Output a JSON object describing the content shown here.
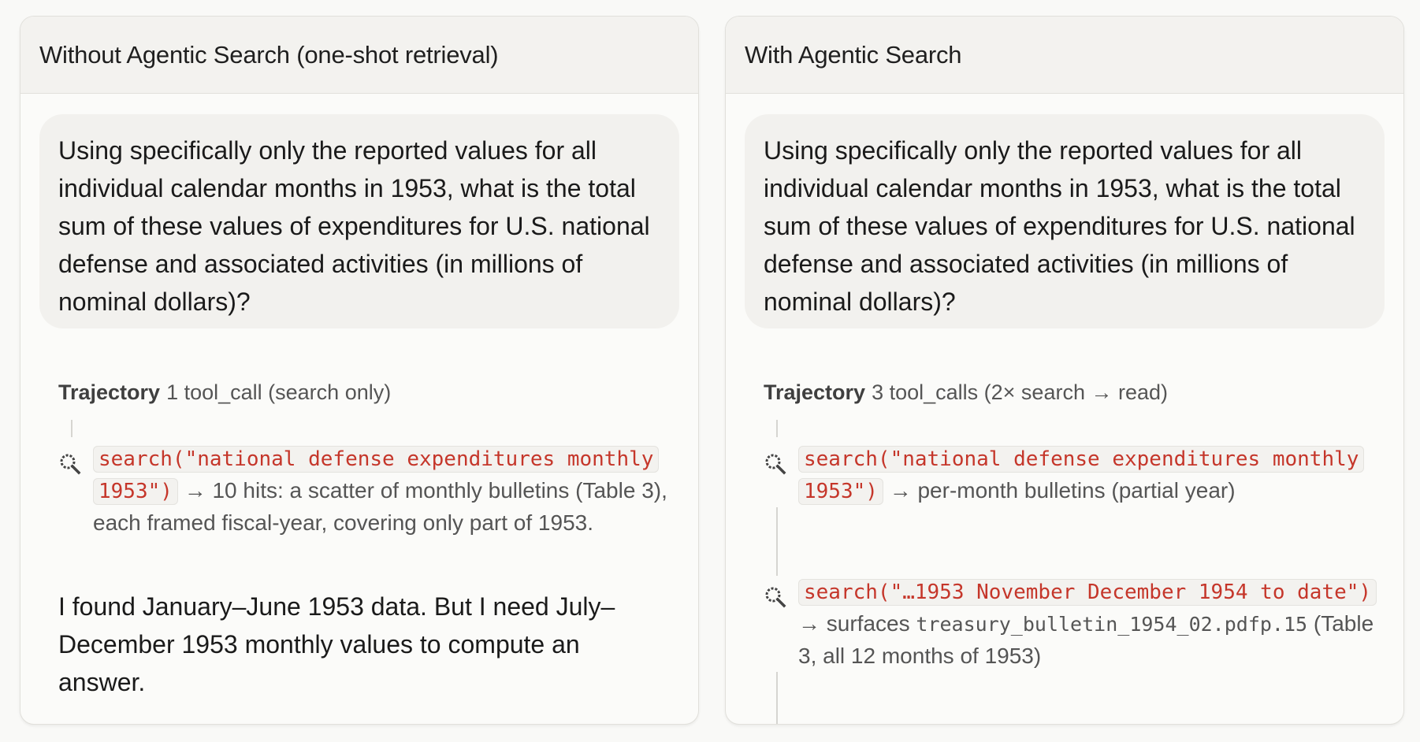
{
  "left_panel": {
    "title": "Without Agentic Search (one-shot retrieval)",
    "question": "Using specifically only the reported values for all individual calendar months in 1953, what is the total sum of these values of expenditures for U.S. national defense and associated activities (in millions of nominal dollars)?",
    "trajectory_label": "Trajectory",
    "trajectory_summary": "1 tool_call (search only)",
    "steps": [
      {
        "icon": "search-icon",
        "call": "search(\"national defense expenditures monthly 1953\")",
        "result": "→ 10 hits: a scatter of monthly bulletins (Table 3), each framed fiscal-year, covering only part of 1953."
      }
    ],
    "answer": "I found January–June 1953 data. But I need July–December 1953 monthly values to compute an answer."
  },
  "right_panel": {
    "title": "With Agentic Search",
    "question": "Using specifically only the reported values for all individual calendar months in 1953, what is the total sum of these values of expenditures for U.S. national defense and associated activities (in millions of nominal dollars)?",
    "trajectory_label": "Trajectory",
    "trajectory_summary": "3 tool_calls (2× search → read)",
    "steps": [
      {
        "icon": "search-icon",
        "call": "search(\"national defense expenditures monthly 1953\")",
        "result": "→ per-month bulletins (partial year)"
      },
      {
        "icon": "search-icon",
        "call": "search(\"…1953 November December 1954 to date\")",
        "result_prefix": "→ surfaces",
        "result_file": "treasury_bulletin_1954_02.pdfp.15",
        "result_suffix": "(Table 3, all 12 months of 1953)"
      }
    ]
  },
  "colors": {
    "code_text": "#c5362a",
    "header_bg": "#f3f2ef",
    "bubble_bg": "#f2f1ee"
  }
}
